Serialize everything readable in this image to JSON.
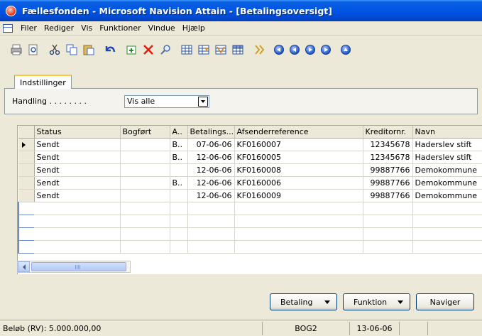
{
  "window": {
    "title": "Fællesfonden - Microsoft Navision Attain - [Betalingsoversigt]"
  },
  "menu": [
    "Filer",
    "Rediger",
    "Vis",
    "Funktioner",
    "Vindue",
    "Hjælp"
  ],
  "toolbar": {
    "icons": [
      "print-icon",
      "print-preview-icon",
      "cut-icon",
      "copy-icon",
      "paste-icon",
      "undo-icon",
      "new-record-icon",
      "delete-icon",
      "find-icon",
      "filter-icon",
      "flow-filter-icon",
      "sort-icon",
      "table-icon",
      "lookup-icon",
      "first-record-icon",
      "previous-record-icon",
      "next-record-icon",
      "last-record-icon",
      "up-icon"
    ]
  },
  "tab": {
    "label": "Indstillinger"
  },
  "options": {
    "label": "Handling . . . . . . . .",
    "value": "Vis alle"
  },
  "table": {
    "columns": [
      "Status",
      "Bogført",
      "A..",
      "Betalings...",
      "Afsenderreference",
      "Kreditornr.",
      "Navn"
    ],
    "rows": [
      [
        "Sendt",
        "",
        "B..",
        "07-06-06",
        "KF0160007",
        "12345678",
        "Haderslev stift"
      ],
      [
        "Sendt",
        "",
        "B..",
        "12-06-06",
        "KF0160005",
        "12345678",
        "Haderslev stift"
      ],
      [
        "Sendt",
        "",
        "",
        "12-06-06",
        "KF0160008",
        "99887766",
        "Demokommune"
      ],
      [
        "Sendt",
        "",
        "B..",
        "12-06-06",
        "KF0160006",
        "99887766",
        "Demokommune"
      ],
      [
        "Sendt",
        "",
        "",
        "12-06-06",
        "KF0160009",
        "99887766",
        "Demokommune"
      ]
    ],
    "selected_row": 0
  },
  "buttons": {
    "betaling": "Betaling",
    "funktion": "Funktion",
    "naviger": "Naviger"
  },
  "status": {
    "amount": "Beløb (RV): 5.000.000,00",
    "company": "BOG2",
    "date": "13-06-06"
  },
  "colors": {
    "titlebar": "#0055e5",
    "window_bg": "#ece9d8",
    "tab_accent": "#ffc83c"
  }
}
